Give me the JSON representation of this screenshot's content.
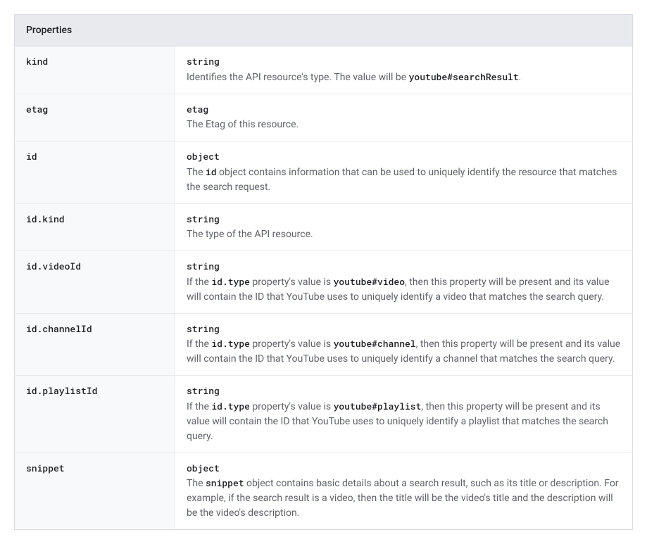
{
  "header": "Properties",
  "rows": [
    {
      "name": "kind",
      "type": "string",
      "desc_segments": [
        {
          "t": "text",
          "v": "Identifies the API resource's type. The value will be "
        },
        {
          "t": "code",
          "v": "youtube#searchResult"
        },
        {
          "t": "text",
          "v": "."
        }
      ]
    },
    {
      "name": "etag",
      "type": "etag",
      "desc_segments": [
        {
          "t": "text",
          "v": "The Etag of this resource."
        }
      ]
    },
    {
      "name": "id",
      "type": "object",
      "desc_segments": [
        {
          "t": "text",
          "v": "The "
        },
        {
          "t": "code",
          "v": "id"
        },
        {
          "t": "text",
          "v": " object contains information that can be used to uniquely identify the resource that matches the search request."
        }
      ]
    },
    {
      "name": "id.kind",
      "type": "string",
      "desc_segments": [
        {
          "t": "text",
          "v": "The type of the API resource."
        }
      ]
    },
    {
      "name": "id.videoId",
      "type": "string",
      "desc_segments": [
        {
          "t": "text",
          "v": "If the "
        },
        {
          "t": "code",
          "v": "id.type"
        },
        {
          "t": "text",
          "v": " property's value is "
        },
        {
          "t": "code",
          "v": "youtube#video"
        },
        {
          "t": "text",
          "v": ", then this property will be present and its value will contain the ID that YouTube uses to uniquely identify a video that matches the search query."
        }
      ]
    },
    {
      "name": "id.channelId",
      "type": "string",
      "desc_segments": [
        {
          "t": "text",
          "v": "If the "
        },
        {
          "t": "code",
          "v": "id.type"
        },
        {
          "t": "text",
          "v": " property's value is "
        },
        {
          "t": "code",
          "v": "youtube#channel"
        },
        {
          "t": "text",
          "v": ", then this property will be present and its value will contain the ID that YouTube uses to uniquely identify a channel that matches the search query."
        }
      ]
    },
    {
      "name": "id.playlistId",
      "type": "string",
      "desc_segments": [
        {
          "t": "text",
          "v": "If the "
        },
        {
          "t": "code",
          "v": "id.type"
        },
        {
          "t": "text",
          "v": " property's value is "
        },
        {
          "t": "code",
          "v": "youtube#playlist"
        },
        {
          "t": "text",
          "v": ", then this property will be present and its value will contain the ID that YouTube uses to uniquely identify a playlist that matches the search query."
        }
      ]
    },
    {
      "name": "snippet",
      "type": "object",
      "desc_segments": [
        {
          "t": "text",
          "v": "The "
        },
        {
          "t": "code",
          "v": "snippet"
        },
        {
          "t": "text",
          "v": " object contains basic details about a search result, such as its title or description. For example, if the search result is a video, then the title will be the video's title and the description will be the video's description."
        }
      ]
    }
  ]
}
